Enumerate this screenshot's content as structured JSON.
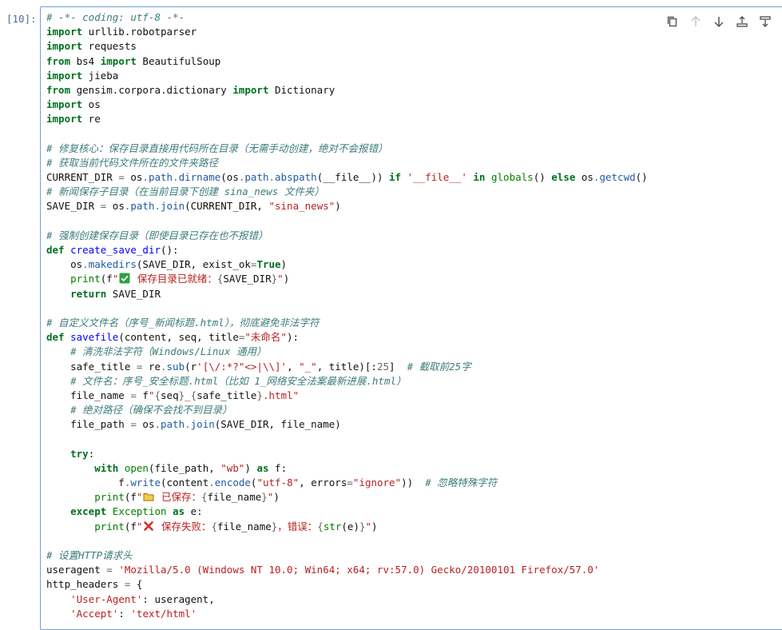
{
  "prompt": "[10]:",
  "toolbar": [
    {
      "name": "copy-icon",
      "enabled": true
    },
    {
      "name": "move-up-icon",
      "enabled": false
    },
    {
      "name": "move-down-icon",
      "enabled": true
    },
    {
      "name": "insert-above-icon",
      "enabled": true
    },
    {
      "name": "insert-below-icon",
      "enabled": true
    }
  ],
  "code": {
    "l1": "# -*- coding: utf-8 -*-",
    "l2a": "import",
    "l2b": " urllib.robotparser",
    "l3a": "import",
    "l3b": " requests",
    "l4a": "from",
    "l4b": " bs4 ",
    "l4c": "import",
    "l4d": " BeautifulSoup",
    "l5a": "import",
    "l5b": " jieba",
    "l6a": "from",
    "l6b": " gensim.corpora.dictionary ",
    "l6c": "import",
    "l6d": " Dictionary",
    "l7a": "import",
    "l7b": " os",
    "l8a": "import",
    "l8b": " re",
    "l10": "# 修复核心：保存目录直接用代码所在目录（无需手动创建，绝对不会报错）",
    "l11": "# 获取当前代码文件所在的文件夹路径",
    "l12a": "CURRENT_DIR ",
    "l12b": "=",
    "l12c": " os",
    "l12d": ".",
    "l12e": "path",
    "l12f": ".",
    "l12g": "dirname",
    "l12h": "(os",
    "l12i": ".",
    "l12j": "path",
    "l12k": ".",
    "l12l": "abspath",
    "l12m": "(__file__)) ",
    "l12n": "if",
    "l12o": " '__file__' ",
    "l12p": "in",
    "l12q": " ",
    "l12r": "globals",
    "l12s": "() ",
    "l12t": "else",
    "l12u": " os",
    "l12v": ".",
    "l12w": "getcwd",
    "l12x": "()",
    "l13": "# 新闻保存子目录（在当前目录下创建 sina_news 文件夹）",
    "l14a": "SAVE_DIR ",
    "l14b": "=",
    "l14c": " os",
    "l14d": ".",
    "l14e": "path",
    "l14f": ".",
    "l14g": "join",
    "l14h": "(CURRENT_DIR, ",
    "l14i": "\"sina_news\"",
    "l14j": ")",
    "l16": "# 强制创建保存目录（即使目录已存在也不报错）",
    "l17a": "def",
    "l17b": " ",
    "l17c": "create_save_dir",
    "l17d": "():",
    "l18a": "    os",
    "l18b": ".",
    "l18c": "makedirs",
    "l18d": "(SAVE_DIR, exist_ok",
    "l18e": "=",
    "l18f": "True",
    "l18g": ")",
    "l19a": "    ",
    "l19b": "print",
    "l19c": "(f",
    "l19d": "\"",
    "l19e": " 保存目录已就绪：",
    "l19f": "{",
    "l19g": "SAVE_DIR",
    "l19h": "}",
    "l19i": "\"",
    "l19j": ")",
    "l20a": "    ",
    "l20b": "return",
    "l20c": " SAVE_DIR",
    "l22": "# 自定义文件名（序号_新闻标题.html），彻底避免非法字符",
    "l23a": "def",
    "l23b": " ",
    "l23c": "savefile",
    "l23d": "(content, seq, title",
    "l23e": "=",
    "l23f": "\"未命名\"",
    "l23g": "):",
    "l24": "    # 清洗非法字符（Windows/Linux 通用）",
    "l25a": "    safe_title ",
    "l25b": "=",
    "l25c": " re",
    "l25d": ".",
    "l25e": "sub",
    "l25f": "(r",
    "l25g": "'[\\/:*?\"<>|\\\\]'",
    "l25h": ", ",
    "l25i": "\"_\"",
    "l25j": ", title)[:",
    "l25k": "25",
    "l25l": "]  ",
    "l25m": "# 截取前25字",
    "l26": "    # 文件名：序号_安全标题.html（比如 1_网络安全法案最新进展.html）",
    "l27a": "    file_name ",
    "l27b": "=",
    "l27c": " f",
    "l27d": "\"",
    "l27e": "{",
    "l27f": "seq",
    "l27g": "}",
    "l27h": "_",
    "l27i": "{",
    "l27j": "safe_title",
    "l27k": "}",
    "l27l": ".html\"",
    "l28": "    # 绝对路径（确保不会找不到目录）",
    "l29a": "    file_path ",
    "l29b": "=",
    "l29c": " os",
    "l29d": ".",
    "l29e": "path",
    "l29f": ".",
    "l29g": "join",
    "l29h": "(SAVE_DIR, file_name)",
    "l31a": "    ",
    "l31b": "try",
    "l31c": ":",
    "l32a": "        ",
    "l32b": "with",
    "l32c": " ",
    "l32d": "open",
    "l32e": "(file_path, ",
    "l32f": "\"wb\"",
    "l32g": ") ",
    "l32h": "as",
    "l32i": " f:",
    "l33a": "            f",
    "l33b": ".",
    "l33c": "write",
    "l33d": "(content",
    "l33e": ".",
    "l33f": "encode",
    "l33g": "(",
    "l33h": "\"utf-8\"",
    "l33i": ", errors",
    "l33j": "=",
    "l33k": "\"ignore\"",
    "l33l": "))  ",
    "l33m": "# 忽略特殊字符",
    "l34a": "        ",
    "l34b": "print",
    "l34c": "(f",
    "l34d": "\"",
    "l34e": " 已保存：",
    "l34f": "{",
    "l34g": "file_name",
    "l34h": "}",
    "l34i": "\"",
    "l34j": ")",
    "l35a": "    ",
    "l35b": "except",
    "l35c": " ",
    "l35d": "Exception",
    "l35e": " ",
    "l35f": "as",
    "l35g": " e:",
    "l36a": "        ",
    "l36b": "print",
    "l36c": "(f",
    "l36d": "\"",
    "l36e": " 保存失败：",
    "l36f": "{",
    "l36g": "file_name",
    "l36h": "}",
    "l36i": "，错误：",
    "l36j": "{",
    "l36k": "str",
    "l36l": "(e)",
    "l36m": "}",
    "l36n": "\"",
    "l36o": ")",
    "l38": "# 设置HTTP请求头",
    "l39a": "useragent ",
    "l39b": "=",
    "l39c": " ",
    "l39d": "'Mozilla/5.0 (Windows NT 10.0; Win64; x64; rv:57.0) Gecko/20100101 Firefox/57.0'",
    "l40a": "http_headers ",
    "l40b": "=",
    "l40c": " {",
    "l41a": "    ",
    "l41b": "'User-Agent'",
    "l41c": ": useragent,",
    "l42a": "    ",
    "l42b": "'Accept'",
    "l42c": ": ",
    "l42d": "'text/html'"
  }
}
